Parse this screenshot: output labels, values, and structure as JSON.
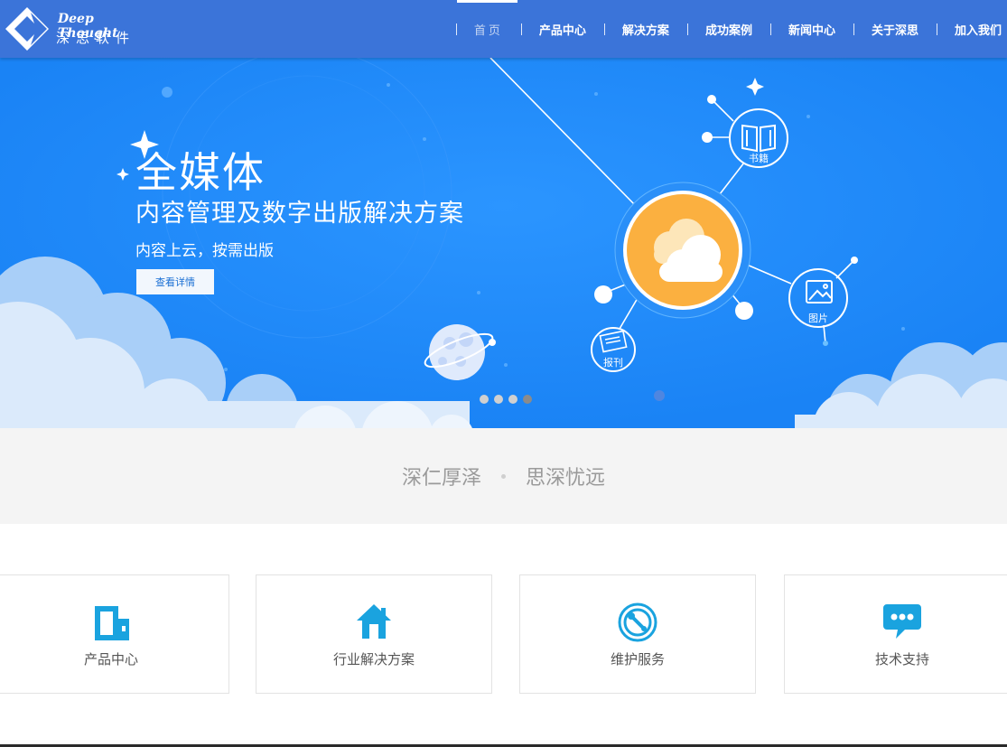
{
  "header": {
    "logo_en": "Deep Thought",
    "logo_cn": "深思软件",
    "nav": [
      {
        "label": "首页",
        "active": true
      },
      {
        "label": "产品中心"
      },
      {
        "label": "解决方案"
      },
      {
        "label": "成功案例"
      },
      {
        "label": "新闻中心"
      },
      {
        "label": "关于深思"
      },
      {
        "label": "加入我们"
      }
    ]
  },
  "banner": {
    "title": "全媒体",
    "subtitle": "内容管理及数字出版解决方案",
    "tagline": "内容上云，按需出版",
    "button": "查看详情",
    "nodes": {
      "books": "书籍",
      "images": "图片",
      "newspaper": "报刊"
    },
    "slides": 4,
    "active_slide": 4
  },
  "slogan": {
    "left": "深仁厚泽",
    "right": "思深忧远"
  },
  "cards": [
    {
      "label": "产品中心",
      "icon": "building-icon"
    },
    {
      "label": "行业解决方案",
      "icon": "house-icon"
    },
    {
      "label": "维护服务",
      "icon": "maintenance-icon"
    },
    {
      "label": "技术支持",
      "icon": "chat-bubble-icon"
    }
  ],
  "colors": {
    "header": "#3b74d9",
    "banner": "#1a83f5",
    "accent_icon": "#1aa3df",
    "cloud_orange": "#fbb040"
  }
}
